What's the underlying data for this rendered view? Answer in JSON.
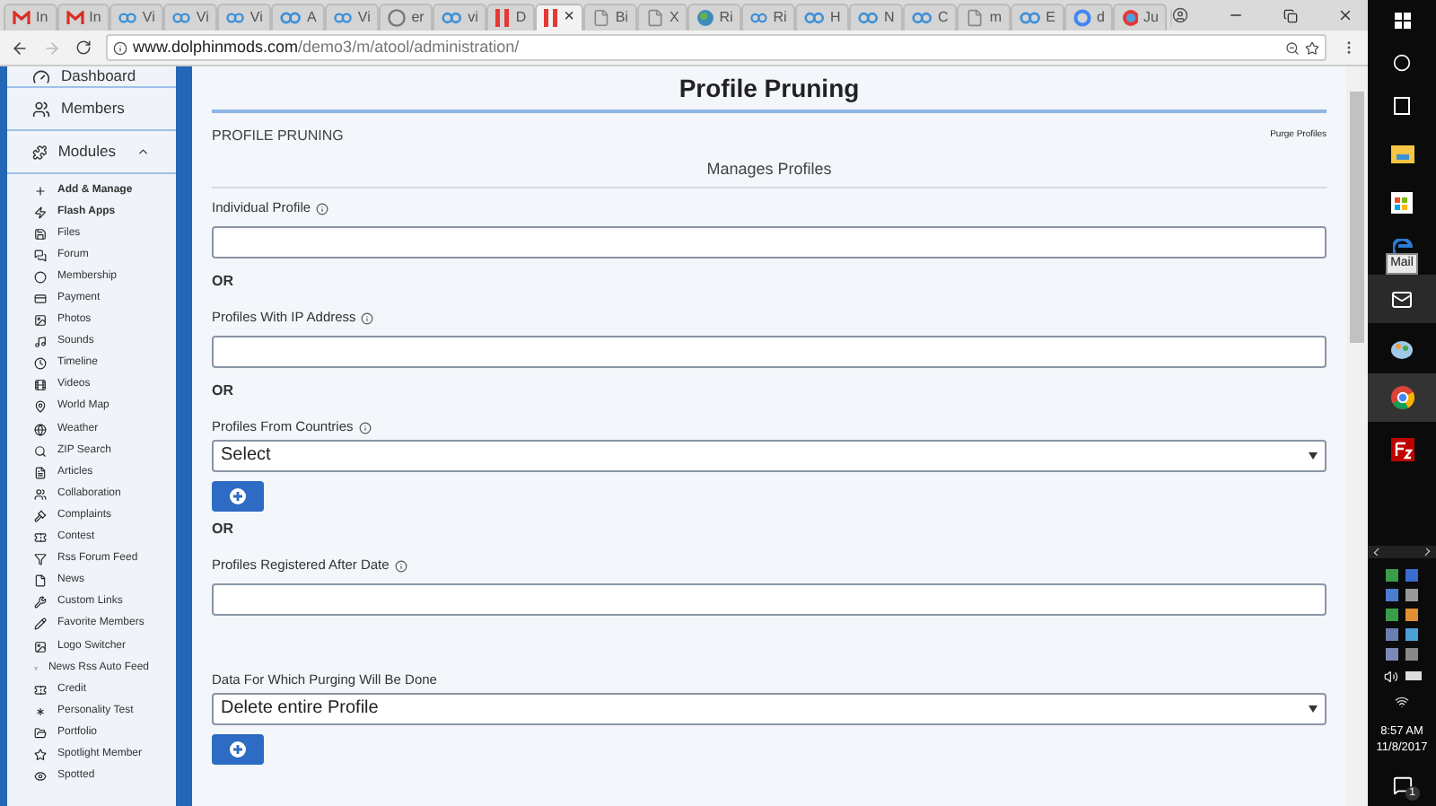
{
  "browser": {
    "tabs": [
      {
        "label": "In",
        "kind": "mail",
        "selected": false
      },
      {
        "label": "In",
        "kind": "mail",
        "selected": false
      },
      {
        "label": "Vi",
        "kind": "loop",
        "selected": false
      },
      {
        "label": "Vi",
        "kind": "loop",
        "selected": false
      },
      {
        "label": "Vi",
        "kind": "loop",
        "selected": false
      },
      {
        "label": "A",
        "kind": "loop",
        "selected": false
      },
      {
        "label": "Vi",
        "kind": "loop",
        "selected": false
      },
      {
        "label": "er",
        "kind": "wp",
        "selected": false
      },
      {
        "label": "vi",
        "kind": "loop",
        "selected": false
      },
      {
        "label": "D",
        "kind": "bars",
        "selected": false
      },
      {
        "close": "×",
        "kind": "bars",
        "selected": true
      },
      {
        "label": "Bi",
        "kind": "doc",
        "selected": false
      },
      {
        "label": "X",
        "kind": "doc",
        "selected": false
      },
      {
        "label": "Ri",
        "kind": "globe",
        "selected": false
      },
      {
        "label": "Ri",
        "kind": "loop",
        "selected": false
      },
      {
        "label": "H",
        "kind": "loop",
        "selected": false
      },
      {
        "label": "N",
        "kind": "loop",
        "selected": false
      },
      {
        "label": "C",
        "kind": "loop",
        "selected": false
      },
      {
        "label": "m",
        "kind": "doc",
        "selected": false
      },
      {
        "label": "E",
        "kind": "loop",
        "selected": false
      },
      {
        "label": "d",
        "kind": "g",
        "selected": false
      },
      {
        "label": "Ju",
        "kind": "circle",
        "selected": false
      }
    ],
    "url_host": "www.dolphinmods.com",
    "url_path": "/demo3/m/atool/administration/"
  },
  "sidebar": {
    "items": [
      {
        "label": "Dashboard"
      },
      {
        "label": "Members"
      },
      {
        "label": "Modules",
        "expanded": true,
        "children": [
          {
            "label": "Add & Manage",
            "bold": true
          },
          {
            "label": "Flash Apps",
            "bold": true
          },
          {
            "label": "Files",
            "bold": false
          },
          {
            "label": "Forum",
            "bold": false
          },
          {
            "label": "Membership",
            "bold": false
          },
          {
            "label": "Payment",
            "bold": false
          },
          {
            "label": "Photos",
            "bold": false
          },
          {
            "label": "Sounds",
            "bold": false
          },
          {
            "label": "Timeline",
            "bold": false
          },
          {
            "label": "Videos",
            "bold": false
          },
          {
            "label": "World Map",
            "bold": false
          },
          {
            "label": "Weather",
            "bold": false
          },
          {
            "label": "ZIP Search",
            "bold": false
          },
          {
            "label": "Articles",
            "bold": false
          },
          {
            "label": "Collaboration",
            "bold": false
          },
          {
            "label": "Complaints",
            "bold": false
          },
          {
            "label": "Contest",
            "bold": false
          },
          {
            "label": "Rss Forum Feed",
            "bold": false
          },
          {
            "label": "News",
            "bold": false
          },
          {
            "label": "Custom Links",
            "bold": false
          },
          {
            "label": "Favorite Members",
            "bold": false
          },
          {
            "label": "Logo Switcher",
            "bold": false
          },
          {
            "label": "News Rss Auto Feed",
            "bold": false
          },
          {
            "label": "Credit",
            "bold": false
          },
          {
            "label": "Personality Test",
            "bold": false
          },
          {
            "label": "Portfolio",
            "bold": false
          },
          {
            "label": "Spotlight Member",
            "bold": false
          },
          {
            "label": "Spotted",
            "bold": false
          }
        ]
      }
    ]
  },
  "page": {
    "title": "Profile Pruning",
    "panel_title": "PROFILE PRUNING",
    "panel_link": "Purge Profiles",
    "subtitle": "Manages Profiles",
    "fields": [
      {
        "kind": "text",
        "label": "Individual Profile"
      },
      {
        "kind": "or",
        "label": "OR"
      },
      {
        "kind": "text",
        "label": "Profiles With IP Address"
      },
      {
        "kind": "or",
        "label": "OR"
      },
      {
        "kind": "select",
        "label": "Profiles From Countries",
        "value": "Select"
      },
      {
        "kind": "or",
        "label": "OR"
      },
      {
        "kind": "text",
        "label": "Profiles Registered After Date"
      },
      {
        "kind": "select_plain",
        "label": "Data For Which Purging Will Be Done",
        "value": "Delete entire Profile"
      }
    ]
  },
  "taskbar": {
    "tooltip": "Mail",
    "time": "8:57 AM",
    "date": "11/8/2017",
    "notifications": "1"
  }
}
